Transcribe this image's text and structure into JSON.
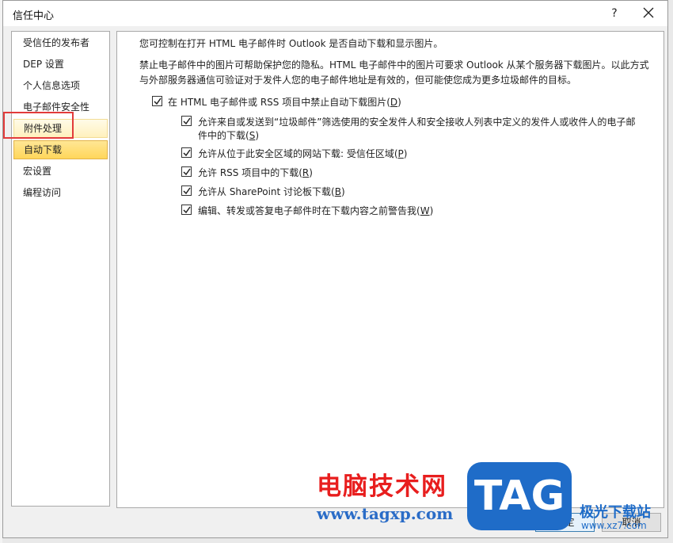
{
  "dialog": {
    "title": "信任中心",
    "help": "?"
  },
  "sidebar": {
    "items": [
      {
        "label": "受信任的发布者"
      },
      {
        "label": "DEP 设置"
      },
      {
        "label": "个人信息选项"
      },
      {
        "label": "电子邮件安全性"
      },
      {
        "label": "附件处理"
      },
      {
        "label": "自动下载"
      },
      {
        "label": "宏设置"
      },
      {
        "label": "编程访问"
      }
    ],
    "selected": "自动下载",
    "highlighted": "附件处理"
  },
  "content": {
    "intro": "您可控制在打开 HTML 电子邮件时 Outlook 是否自动下载和显示图片。",
    "desc_line1": "禁止电子邮件中的图片可帮助保护您的隐私。HTML 电子邮件中的图片可要求 Outlook 从某个服务器下载图片。以此方式",
    "desc_line2": "与外部服务器通信可验证对于发件人您的电子邮件地址是有效的，但可能使您成为更多垃圾邮件的目标。",
    "main_option": {
      "label": "在 HTML 电子邮件或 RSS 项目中禁止自动下载图片(",
      "key": "D",
      "end": ")",
      "checked": true
    },
    "sub_options": [
      {
        "label_line1": "允许来自或发送到“垃圾邮件”筛选使用的安全发件人和安全接收人列表中定义的发件人或收件人的电子邮",
        "label_line2": "件中的下载(",
        "key": "S",
        "end": ")",
        "checked": true
      },
      {
        "label_line1": "允许从位于此安全区域的网站下载: 受信任区域(",
        "key": "P",
        "end": ")",
        "checked": true
      },
      {
        "label_line1": "允许 RSS 项目中的下载(",
        "key": "R",
        "end": ")",
        "checked": true
      },
      {
        "label_line1": "允许从 SharePoint 讨论板下载(",
        "key": "B",
        "end": ")",
        "checked": true
      },
      {
        "label_line1": "编辑、转发或答复电子邮件时在下载内容之前警告我(",
        "key": "W",
        "end": ")",
        "checked": true
      }
    ]
  },
  "buttons": {
    "ok": "确定",
    "cancel": "取消"
  },
  "watermark": {
    "cn_text": "电脑技术网",
    "url": "www.tagxp.com",
    "tag": "TAG",
    "site_cn": "极光下载站",
    "site_url": "www.xz7.com"
  },
  "colors": {
    "selected_bg": "#ffd65a",
    "annotation_red": "#e23b3b",
    "watermark_blue": "#1f6cc8"
  }
}
